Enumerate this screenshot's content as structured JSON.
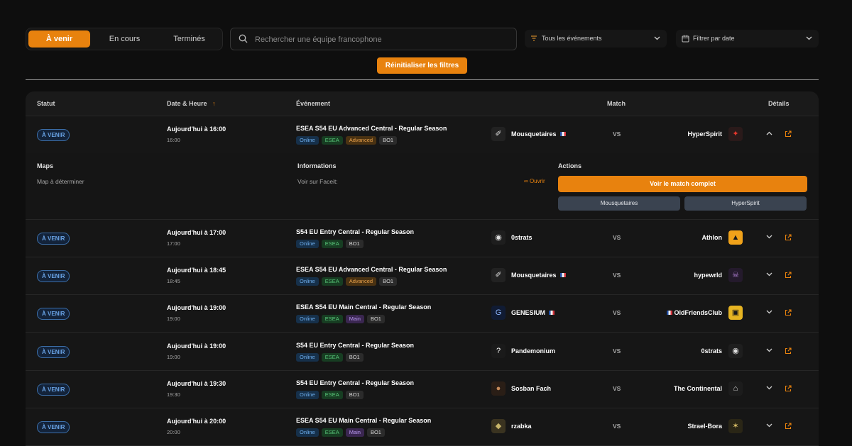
{
  "tabs": [
    {
      "label": "À venir",
      "active": true
    },
    {
      "label": "En cours",
      "active": false
    },
    {
      "label": "Terminés",
      "active": false
    }
  ],
  "search": {
    "placeholder": "Rechercher une équipe francophone",
    "value": ""
  },
  "filters": {
    "events": "Tous les événements",
    "date": "Filtrer par date"
  },
  "reset_label": "Réinitialiser les filtres",
  "table": {
    "headers": {
      "status": "Statut",
      "datetime": "Date & Heure",
      "sort_arrow": "↑",
      "event": "Événement",
      "match": "Match",
      "details": "Détails"
    },
    "vs": "VS",
    "rows": [
      {
        "status": "À VENIR",
        "date": "Aujourd'hui à 16:00",
        "time": "16:00",
        "event": "ESEA S54 EU Advanced Central - Regular Season",
        "tags": [
          "Online",
          "ESEA",
          "Advanced",
          "BO1"
        ],
        "team1": "Mousquetaires",
        "team1_flag": true,
        "team1_logo": "bird-logo",
        "team2": "HyperSpirit",
        "team2_flag": false,
        "team2_logo": "star-logo",
        "expanded": true
      },
      {
        "status": "À VENIR",
        "date": "Aujourd'hui à 17:00",
        "time": "17:00",
        "event": "S54 EU Entry Central - Regular Season",
        "tags": [
          "Online",
          "ESEA",
          "BO1"
        ],
        "team1": "0strats",
        "team1_flag": false,
        "team1_logo": "ring-logo",
        "team2": "Athlon",
        "team2_flag": false,
        "team2_logo": "triangle-logo",
        "expanded": false
      },
      {
        "status": "À VENIR",
        "date": "Aujourd'hui à 18:45",
        "time": "18:45",
        "event": "ESEA S54 EU Advanced Central - Regular Season",
        "tags": [
          "Online",
          "ESEA",
          "Advanced",
          "BO1"
        ],
        "team1": "Mousquetaires",
        "team1_flag": true,
        "team1_logo": "bird-logo",
        "team2": "hypewrld",
        "team2_flag": false,
        "team2_logo": "skull-logo",
        "expanded": false
      },
      {
        "status": "À VENIR",
        "date": "Aujourd'hui à 19:00",
        "time": "19:00",
        "event": "ESEA S54 EU Main Central - Regular Season",
        "tags": [
          "Online",
          "ESEA",
          "Main",
          "BO1"
        ],
        "team1": "GENESIUM",
        "team1_flag": true,
        "team1_logo": "g-logo",
        "team2": "OldFriendsClub",
        "team2_flag": true,
        "team2_logo": "ofc-logo",
        "expanded": false
      },
      {
        "status": "À VENIR",
        "date": "Aujourd'hui à 19:00",
        "time": "19:00",
        "event": "S54 EU Entry Central - Regular Season",
        "tags": [
          "Online",
          "ESEA",
          "BO1"
        ],
        "team1": "Pandemonium",
        "team1_flag": false,
        "team1_logo": "question-logo",
        "team2": "0strats",
        "team2_flag": false,
        "team2_logo": "ring-logo",
        "expanded": false
      },
      {
        "status": "À VENIR",
        "date": "Aujourd'hui à 19:30",
        "time": "19:30",
        "event": "S54 EU Entry Central - Regular Season",
        "tags": [
          "Online",
          "ESEA",
          "BO1"
        ],
        "team1": "Sosban Fach",
        "team1_flag": false,
        "team1_logo": "person-logo",
        "team2": "The Continental",
        "team2_flag": false,
        "team2_logo": "tc-logo",
        "expanded": false
      },
      {
        "status": "À VENIR",
        "date": "Aujourd'hui à 20:00",
        "time": "20:00",
        "event": "ESEA S54 EU Main Central - Regular Season",
        "tags": [
          "Online",
          "ESEA",
          "Main",
          "BO1"
        ],
        "team1": "rzabka",
        "team1_flag": false,
        "team1_logo": "frog-logo",
        "team2": "Strael-Bora",
        "team2_flag": false,
        "team2_logo": "emblem-logo",
        "expanded": false
      }
    ],
    "expanded": {
      "maps_title": "Maps",
      "maps_value": "Map à déterminer",
      "info_title": "Informations",
      "info_label": "Voir sur Faceit:",
      "info_link": "Ouvrir",
      "actions_title": "Actions",
      "full_match_button": "Voir le match complet",
      "team1_button": "Mousquetaires",
      "team2_button": "HyperSpirit"
    }
  },
  "colors": {
    "accent": "#e8820e",
    "background": "#0e0e0e",
    "panel": "#161616",
    "status_blue": "#6aa4e6"
  }
}
